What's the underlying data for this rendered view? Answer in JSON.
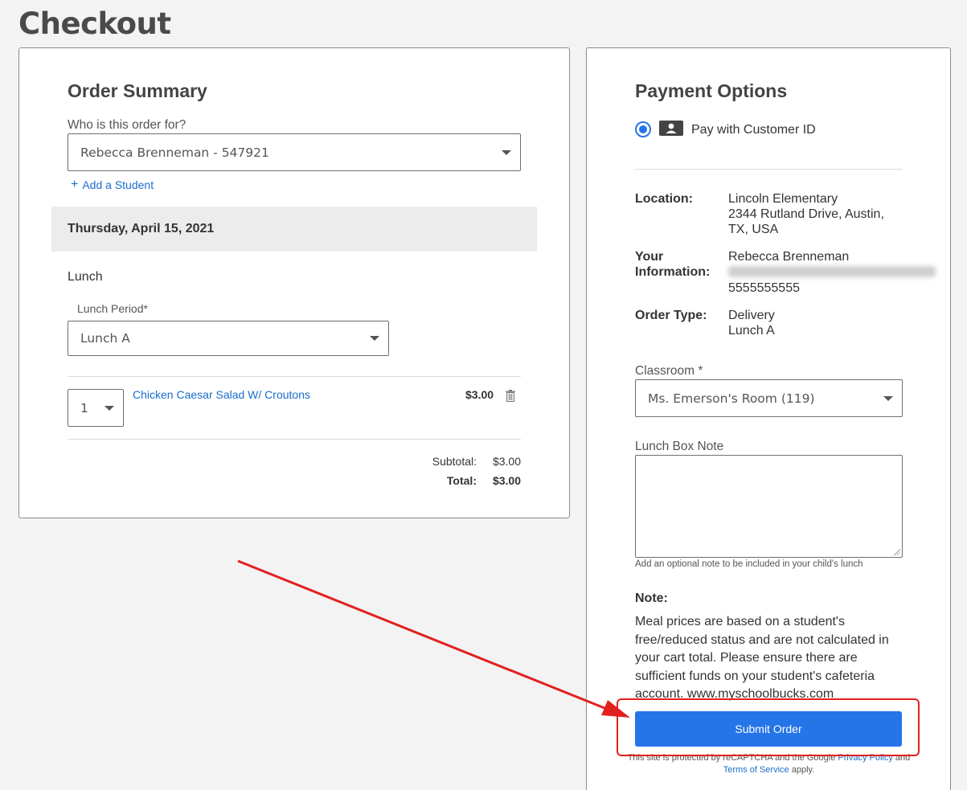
{
  "page": {
    "title": "Checkout"
  },
  "order_summary": {
    "heading": "Order Summary",
    "who_label": "Who is this order for?",
    "student_selected": "Rebecca Brenneman - 547921",
    "add_student": "Add a Student",
    "add_student_icon": "plus-icon",
    "date": "Thursday, April 15, 2021",
    "meal": "Lunch",
    "lunch_period_label": "Lunch Period*",
    "lunch_period_selected": "Lunch A",
    "items": [
      {
        "qty": "1",
        "name": "Chicken Caesar Salad W/ Croutons",
        "price": "$3.00",
        "icon": "trash-icon"
      }
    ],
    "subtotal_label": "Subtotal:",
    "subtotal_value": "$3.00",
    "total_label": "Total:",
    "total_value": "$3.00"
  },
  "payment": {
    "heading": "Payment Options",
    "method_label": "Pay with Customer ID",
    "method_icon": "person-card-icon",
    "location_label": "Location:",
    "location_name": "Lincoln Elementary",
    "location_address_1": "2344 Rutland Drive, Austin,",
    "location_address_2": "TX, USA",
    "your_info_label_1": "Your",
    "your_info_label_2": "Information:",
    "your_info_name": "Rebecca Brenneman",
    "your_info_phone": "5555555555",
    "order_type_label": "Order Type:",
    "order_type_value_1": "Delivery",
    "order_type_value_2": "Lunch A",
    "classroom_label": "Classroom *",
    "classroom_selected": "Ms. Emerson's Room (119)",
    "note_label": "Lunch Box Note",
    "note_help": "Add an optional note to be included in your child's lunch",
    "note_heading": "Note:",
    "note_lines": [
      "Meal prices are based on a student's",
      "free/reduced status and are not calculated in",
      "your cart total. Please ensure there are",
      "sufficient funds on your student's cafeteria",
      "account. www.myschoolbucks.com"
    ],
    "submit_label": "Submit Order",
    "recaptcha_prefix": "This site is protected by reCAPTCHA and the Google ",
    "privacy_link": "Privacy Policy",
    "recaptcha_and": " and ",
    "terms_link": "Terms of Service",
    "recaptcha_suffix": " apply."
  },
  "colors": {
    "accent": "#2574e8",
    "link": "#1a6dcc",
    "annotation": "#e32020"
  }
}
